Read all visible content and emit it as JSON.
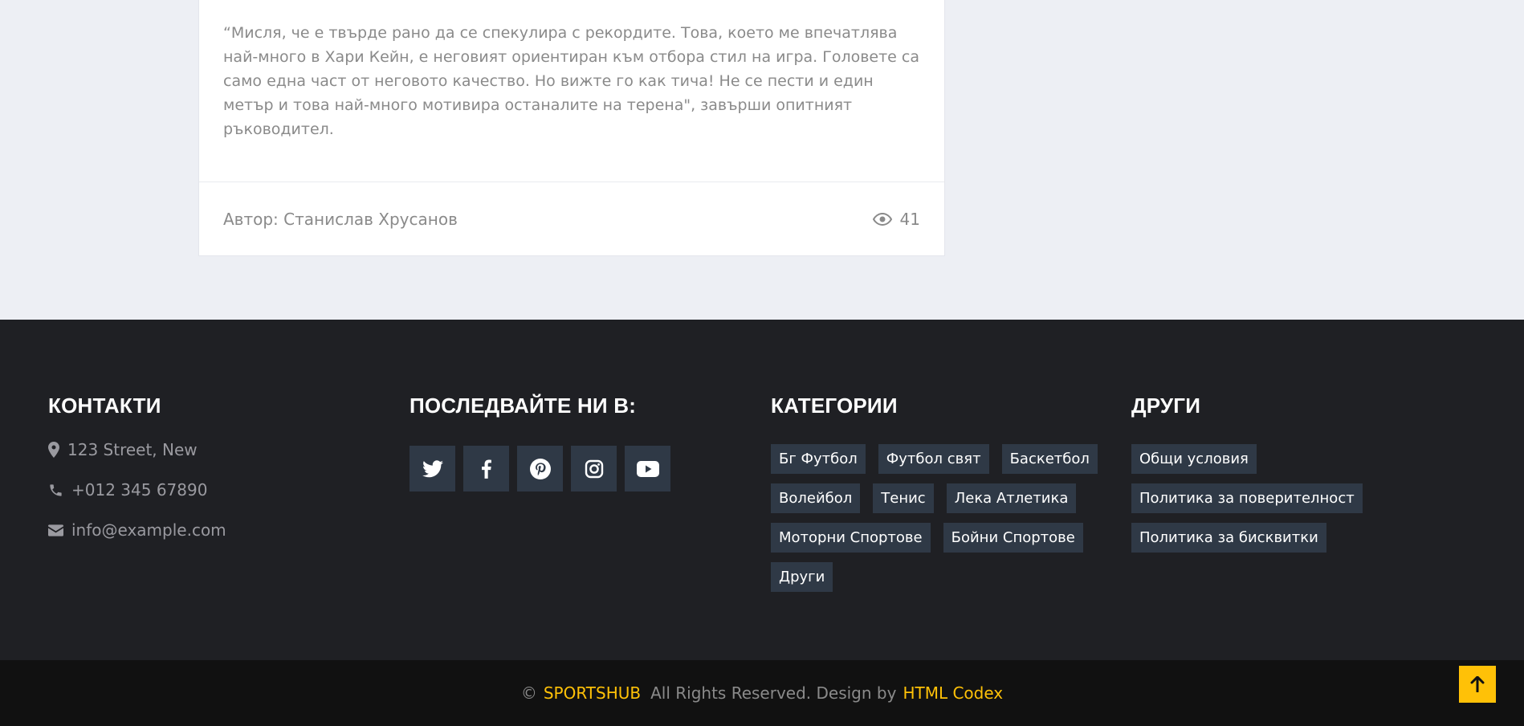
{
  "article": {
    "quote": "“Мисля, че е твърде рано да се спекулира с рекордите. Това, което ме впечатлява най-много в Хари Кейн, е неговият ориентиран към отбора стил на игра. Головете са само една част от неговото качество. Но вижте го как тича! Не се пести и един метър и това най-много мотивира останалите на терена\", завърши опитният ръководител.",
    "author": "Автор: Станислав Хрусанов",
    "views": "41",
    "views_icon": "eye-icon"
  },
  "footer": {
    "contacts": {
      "title": "КОНТАКТИ",
      "address": "123 Street, New",
      "phone": "+012 345 67890",
      "email": "info@example.com"
    },
    "follow": {
      "title": "ПОСЛЕДВАЙТЕ НИ В:",
      "networks": [
        "twitter",
        "facebook",
        "pinterest",
        "instagram",
        "youtube"
      ]
    },
    "categories": {
      "title": "КАТЕГОРИИ",
      "items": [
        "Бг Футбол",
        "Футбол свят",
        "Баскетбол",
        "Волейбол",
        "Тенис",
        "Лека Атлетика",
        "Моторни Спортове",
        "Бойни Спортове",
        "Други"
      ]
    },
    "others": {
      "title": "ДРУГИ",
      "items": [
        "Общи условия",
        "Политика за поверителност",
        "Политика за бисквитки"
      ]
    }
  },
  "copyright": {
    "symbol": "©",
    "brand": "SPORTSHUB",
    "middle": "All Rights Reserved. Design by",
    "designer": "HTML Codex"
  },
  "colors": {
    "accent": "#ffc107",
    "footer_bg": "#1f2024",
    "tag_bg": "#2f3946",
    "page_bg": "#edeff4"
  }
}
